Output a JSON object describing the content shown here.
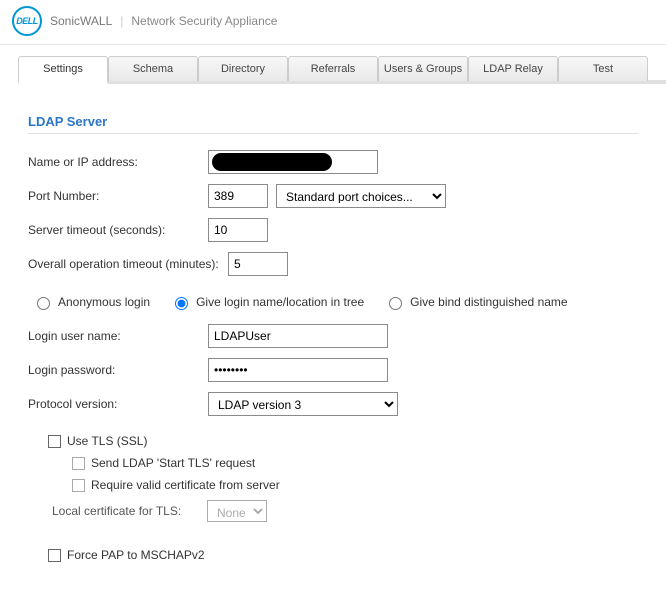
{
  "header": {
    "logo_text": "DELL",
    "brand": "SonicWALL",
    "product": "Network Security Appliance"
  },
  "tabs": [
    {
      "label": "Settings",
      "active": true
    },
    {
      "label": "Schema"
    },
    {
      "label": "Directory"
    },
    {
      "label": "Referrals"
    },
    {
      "label": "Users & Groups"
    },
    {
      "label": "LDAP Relay"
    },
    {
      "label": "Test"
    }
  ],
  "section_title": "LDAP Server",
  "fields": {
    "ip_label": "Name or IP address:",
    "ip_value": "",
    "port_label": "Port Number:",
    "port_value": "389",
    "port_choice_label": "Standard port choices...",
    "server_timeout_label": "Server timeout (seconds):",
    "server_timeout_value": "10",
    "op_timeout_label": "Overall operation timeout (minutes):",
    "op_timeout_value": "5"
  },
  "login_mode": {
    "anonymous": "Anonymous login",
    "give_name": "Give login name/location in tree",
    "give_bind": "Give bind distinguished name",
    "selected": "give_name"
  },
  "login": {
    "user_label": "Login user name:",
    "user_value": "LDAPUser",
    "pass_label": "Login password:",
    "pass_value": "••••••••",
    "proto_label": "Protocol version:",
    "proto_value": "LDAP version 3"
  },
  "tls": {
    "use_tls": "Use TLS (SSL)",
    "start_tls": "Send LDAP 'Start TLS' request",
    "require_cert": "Require valid certificate from server",
    "local_cert_label": "Local certificate for TLS:",
    "local_cert_value": "None"
  },
  "force_pap": "Force PAP to MSCHAPv2"
}
